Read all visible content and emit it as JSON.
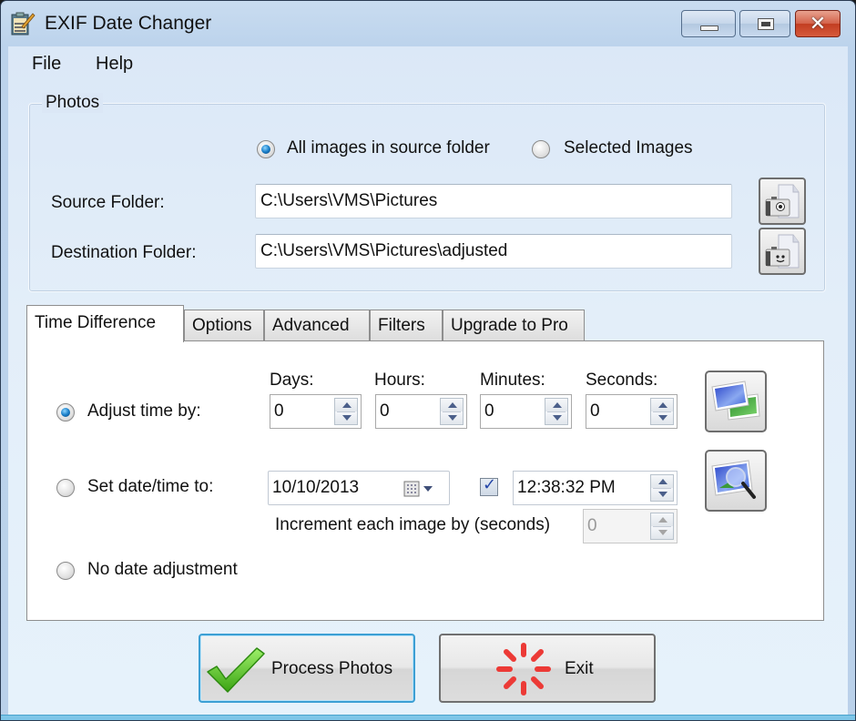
{
  "window": {
    "title": "EXIF Date Changer",
    "controls": {
      "minimize": "minimize",
      "maximize": "maximize",
      "close": "close"
    },
    "close_glyph": "✕"
  },
  "menu": {
    "items": [
      "File",
      "Help"
    ]
  },
  "photos_group": {
    "label": "Photos",
    "scope_options": [
      {
        "label": "All images in source folder",
        "selected": true
      },
      {
        "label": "Selected Images",
        "selected": false
      }
    ],
    "source_folder": {
      "label": "Source Folder:",
      "value": "C:\\Users\\VMS\\Pictures"
    },
    "destination_folder": {
      "label": "Destination Folder:",
      "value": "C:\\Users\\VMS\\Pictures\\adjusted"
    }
  },
  "tabs": [
    {
      "label": "Time Difference",
      "active": true
    },
    {
      "label": "Options",
      "active": false
    },
    {
      "label": "Advanced",
      "active": false
    },
    {
      "label": "Filters",
      "active": false
    },
    {
      "label": "Upgrade to Pro",
      "active": false
    }
  ],
  "time_difference": {
    "mode_options": [
      {
        "label": "Adjust time by:",
        "selected": true
      },
      {
        "label": "Set date/time to:",
        "selected": false
      },
      {
        "label": "No date adjustment",
        "selected": false
      }
    ],
    "adjust": {
      "days": {
        "label": "Days:",
        "value": "0"
      },
      "hours": {
        "label": "Hours:",
        "value": "0"
      },
      "minutes": {
        "label": "Minutes:",
        "value": "0"
      },
      "seconds": {
        "label": "Seconds:",
        "value": "0"
      }
    },
    "set_datetime": {
      "date": "10/10/2013",
      "time_enabled": true,
      "time": "12:38:32 PM",
      "increment_label": "Increment each image by (seconds)",
      "increment_value": "0",
      "increment_enabled": false
    }
  },
  "buttons": {
    "process": "Process Photos",
    "exit": "Exit"
  },
  "colors": {
    "accent_focus": "#3c9fd4",
    "radio_selected": "#1a7fc9",
    "close_button": "#c23d21",
    "process_icon": "#4cbf1c",
    "exit_icon": "#e8322e"
  }
}
